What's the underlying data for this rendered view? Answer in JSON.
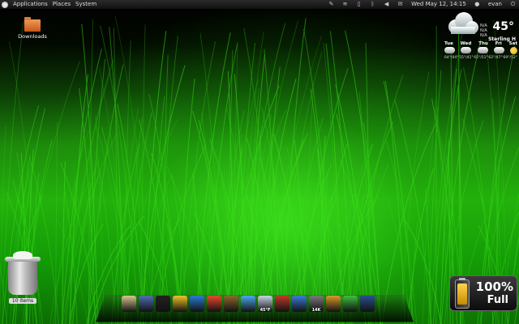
{
  "top_panel": {
    "menus": [
      "Applications",
      "Places",
      "System"
    ],
    "datetime": "Wed May 12, 14:15",
    "user": "evan"
  },
  "desktop": {
    "downloads_label": "Downloads",
    "trash_label": "10 items"
  },
  "weather": {
    "temperature": "45°",
    "small_lines": [
      "N/A",
      "N/A",
      "N/A"
    ],
    "location": "Sterling H",
    "days": [
      "Tue",
      "Wed",
      "Thu",
      "Fri",
      "Sat"
    ],
    "ranges": [
      "64°/44°",
      "55°/41°",
      "65°/51°",
      "62°/47°",
      "69°/52°"
    ]
  },
  "dock": {
    "items": [
      {
        "icon": "text-editor-icon",
        "color": "#d8c890",
        "label": ""
      },
      {
        "icon": "package-icon",
        "color": "#4f6fb3",
        "label": ""
      },
      {
        "icon": "terminal-icon",
        "color": "#222222",
        "label": ""
      },
      {
        "icon": "files-icon",
        "color": "#f2c32a",
        "label": ""
      },
      {
        "icon": "globe-icon",
        "color": "#2a7bd6",
        "label": ""
      },
      {
        "icon": "chrome-icon",
        "color": "#e44a2b",
        "label": ""
      },
      {
        "icon": "phone-icon",
        "color": "#8b6a2c",
        "label": ""
      },
      {
        "icon": "chat-icon",
        "color": "#4ba8f0",
        "label": ""
      },
      {
        "icon": "weather-icon",
        "color": "#c8d6e4",
        "label": "45°F"
      },
      {
        "icon": "video-icon",
        "color": "#c0392b",
        "label": ""
      },
      {
        "icon": "clapper-icon",
        "color": "#3d7ad8",
        "label": ""
      },
      {
        "icon": "download-icon",
        "color": "#7a7a7a",
        "label": "14K"
      },
      {
        "icon": "archive-icon",
        "color": "#d99a2b",
        "label": ""
      },
      {
        "icon": "battery-icon",
        "color": "#3fbf3f",
        "label": ""
      },
      {
        "icon": "cursor-icon",
        "color": "#2b4f8f",
        "label": ""
      }
    ]
  },
  "battery": {
    "percent": "100%",
    "state": "Full"
  }
}
